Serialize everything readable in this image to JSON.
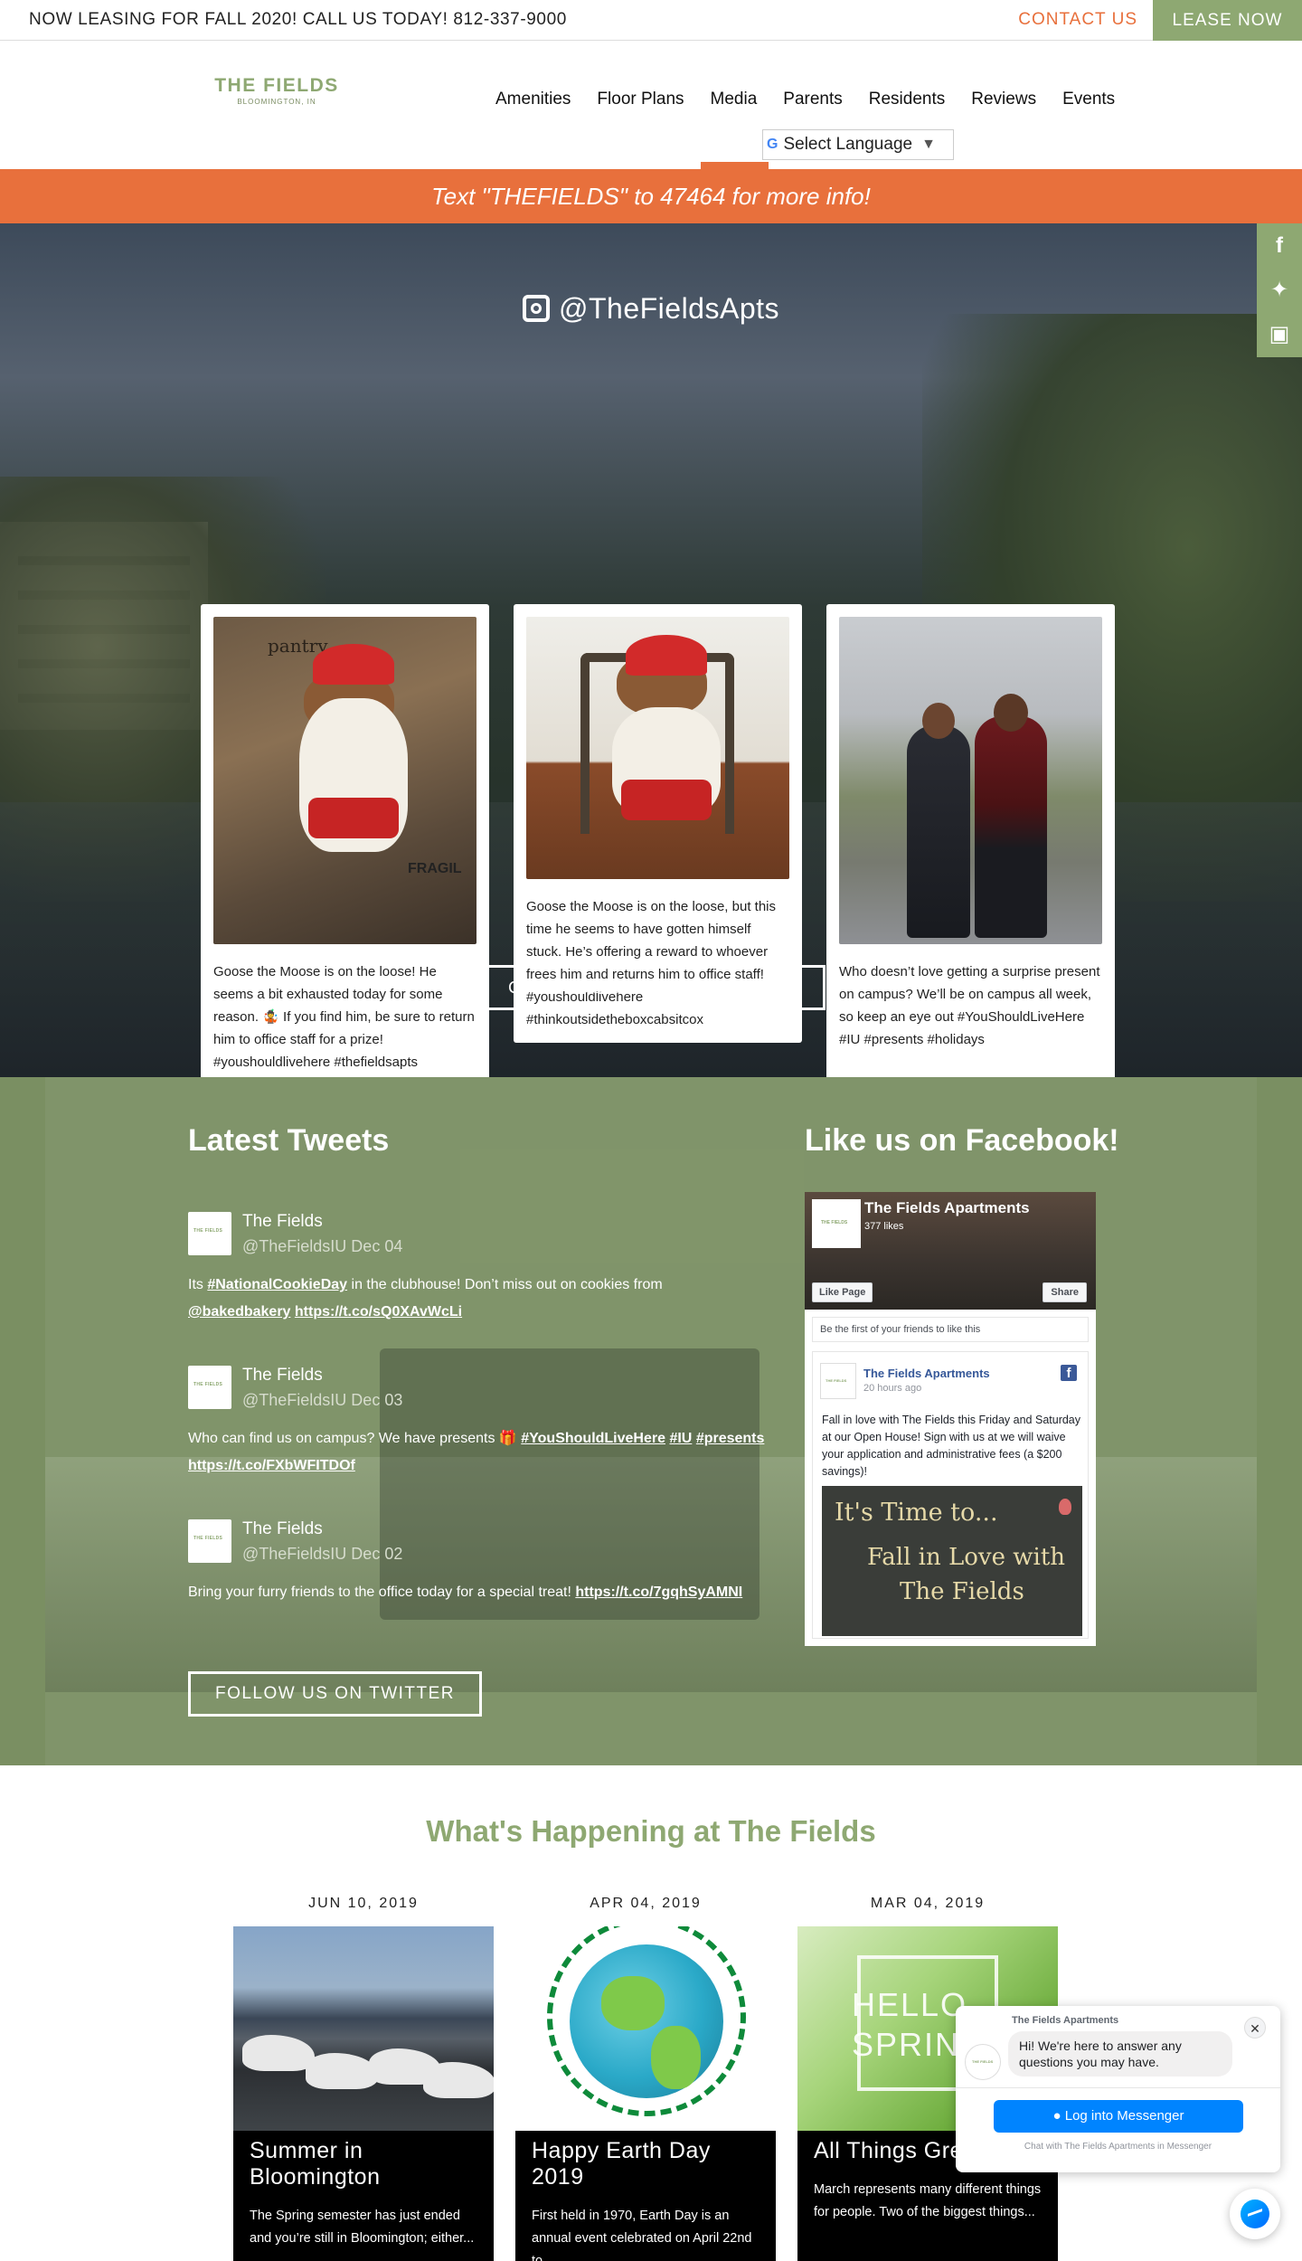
{
  "topbar": {
    "announcement": "NOW LEASING FOR FALL 2020! CALL US TODAY! 812-337-9000",
    "contact_label": "CONTACT US",
    "lease_label": "LEASE NOW"
  },
  "header": {
    "logo_name": "THE FIELDS",
    "logo_location": "BLOOMINGTON, IN",
    "nav": [
      "Amenities",
      "Floor Plans",
      "Media",
      "Parents",
      "Residents",
      "Reviews",
      "Events"
    ],
    "language_select": "Select Language"
  },
  "promo": {
    "text": "Text \"THEFIELDS\" to 47464 for more info!"
  },
  "social": {
    "items": [
      "facebook-icon",
      "twitter-icon",
      "instagram-icon"
    ]
  },
  "instagram": {
    "handle": "@TheFieldsApts",
    "posts": [
      {
        "caption": "Goose the Moose is on the loose! He seems a bit exhausted today for some reason. 🤹 If you find him, be sure to return him to office staff for a prize! #youshouldlivehere #thefieldsapts",
        "box_text": "pantry",
        "box_text2": "FRAGIL"
      },
      {
        "caption": "Goose the Moose is on the loose, but this time he seems to have gotten himself stuck. He’s offering a reward to whoever frees him and returns him to office staff! #youshouldlivehere #thinkoutsidetheboxcabsitcox​"
      },
      {
        "caption": "Who doesn’t love getting a surprise present on campus? We’ll be on campus all week, so keep an eye out #YouShouldLiveHere #IU #presents #holidays"
      }
    ],
    "button_label": "CHECK US OUT ON INSTAGRAM"
  },
  "tweets": {
    "title": "Latest Tweets",
    "items": [
      {
        "name": "The Fields",
        "handle": "@TheFieldsIU Dec 04",
        "pre": "Its ",
        "tag1": "#NationalCookieDay",
        "mid": " in the clubhouse! Don’t miss out on cookies from ",
        "mention": "@bakedbakery",
        "link": "https://t.co/sQ0XAvWcLi"
      },
      {
        "name": "The Fields",
        "handle": "@TheFieldsIU Dec 03",
        "pre": "Who can find us on campus? We have presents 🎁 ",
        "tag1": "#YouShouldLiveHere",
        "tag2": "#IU",
        "tag3": "#presents",
        "link": "https://t.co/FXbWFITDOf"
      },
      {
        "name": "The Fields",
        "handle": "@TheFieldsIU Dec 02",
        "pre": "Bring your furry friends to the office today for a special treat! ",
        "link": "https://t.co/7gqhSyAMNI"
      }
    ],
    "button_label": "FOLLOW US ON TWITTER"
  },
  "facebook": {
    "title": "Like us on Facebook!",
    "page_name": "The Fields Apartments",
    "likes": "377 likes",
    "like_button": "Like Page",
    "share_button": "Share",
    "friends_text": "Be the first of your friends to like this",
    "post": {
      "author": "The Fields Apartments",
      "time": "20 hours ago",
      "text": "Fall in love with The Fields this Friday and Saturday at our Open House! Sign with us at we will waive your application and administrative fees (a $200 savings)!",
      "chalk_line1": "It's Time to...",
      "chalk_line2": "Fall in Love with",
      "chalk_line3": "The Fields"
    }
  },
  "events": {
    "title": "What's Happening at The Fields",
    "items": [
      {
        "date": "JUN 10, 2019",
        "title": "Summer in Bloomington",
        "desc": "The Spring semester has just ended and you’re still in Bloomington; either..."
      },
      {
        "date": "APR 04, 2019",
        "title": "Happy Earth Day 2019",
        "desc": "First held in 1970, Earth Day is an annual event celebrated on April 22nd to..."
      },
      {
        "date": "MAR 04, 2019",
        "title": "All Things Green",
        "desc": "March represents many different things for people. Two of the biggest things...",
        "image_text": "HELLO SPRING"
      }
    ]
  },
  "messenger": {
    "header": "The Fields Apartments",
    "message": "Hi! We're here to answer any questions you may have.",
    "login_label": "Log into Messenger",
    "footer": "Chat with The Fields Apartments in Messenger"
  }
}
